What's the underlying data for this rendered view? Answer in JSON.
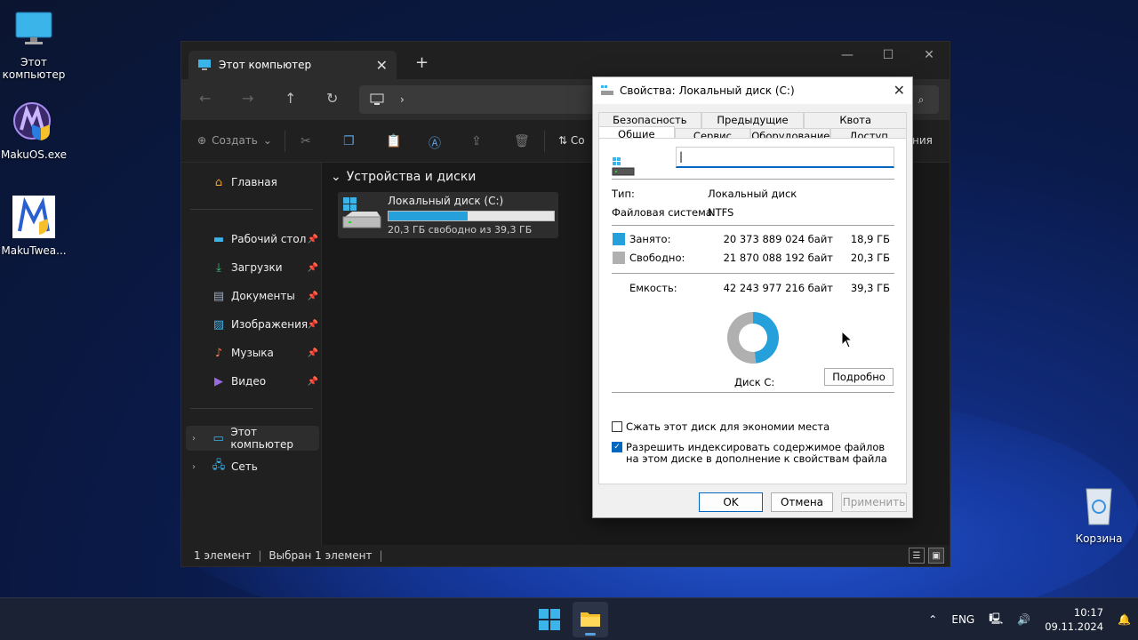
{
  "desktop": {
    "icons": [
      {
        "label": "Этот компьютер"
      },
      {
        "label": "MakuOS.exe"
      },
      {
        "label": "MakuTwea..."
      },
      {
        "label": "Корзина"
      }
    ]
  },
  "explorer": {
    "tab_title": "Этот компьютер",
    "toolbar": {
      "create_label": "Создать",
      "clipped_label": "Со",
      "right_clipped": "ния"
    },
    "sidebar": {
      "home": "Главная",
      "quick": [
        {
          "label": "Рабочий стол"
        },
        {
          "label": "Загрузки"
        },
        {
          "label": "Документы"
        },
        {
          "label": "Изображения"
        },
        {
          "label": "Музыка"
        },
        {
          "label": "Видео"
        }
      ],
      "this_pc": "Этот компьютер",
      "network": "Сеть"
    },
    "section_title": "Устройства и диски",
    "drive": {
      "name": "Локальный диск (C:)",
      "free_text": "20,3 ГБ свободно из 39,3 ГБ",
      "used_fraction": 0.48
    },
    "status": {
      "count": "1 элемент",
      "selected": "Выбран 1 элемент"
    }
  },
  "dialog": {
    "title": "Свойства: Локальный диск (C:)",
    "tabs_row1": [
      "Безопасность",
      "Предыдущие версии",
      "Квота"
    ],
    "tabs_row2": [
      "Общие",
      "Сервис",
      "Оборудование",
      "Доступ"
    ],
    "name_value": "",
    "type_label": "Тип:",
    "type_value": "Локальный диск",
    "fs_label": "Файловая система:",
    "fs_value": "NTFS",
    "used_label": "Занято:",
    "used_bytes": "20 373 889 024 байт",
    "used_gb": "18,9 ГБ",
    "free_label": "Свободно:",
    "free_bytes": "21 870 088 192 байт",
    "free_gb": "20,3 ГБ",
    "cap_label": "Емкость:",
    "cap_bytes": "42 243 977 216 байт",
    "cap_gb": "39,3 ГБ",
    "disk_label": "Диск C:",
    "details_button": "Подробно",
    "compress_label": "Сжать этот диск для экономии места",
    "compress_checked": false,
    "index_label": "Разрешить индексировать содержимое файлов на этом диске в дополнение к свойствам файла",
    "index_checked": true,
    "ok": "OK",
    "cancel": "Отмена",
    "apply": "Применить",
    "colors": {
      "used": "#26a0da",
      "free": "#b0b0b0"
    }
  },
  "taskbar": {
    "lang": "ENG",
    "time": "10:17",
    "date": "09.11.2024"
  }
}
